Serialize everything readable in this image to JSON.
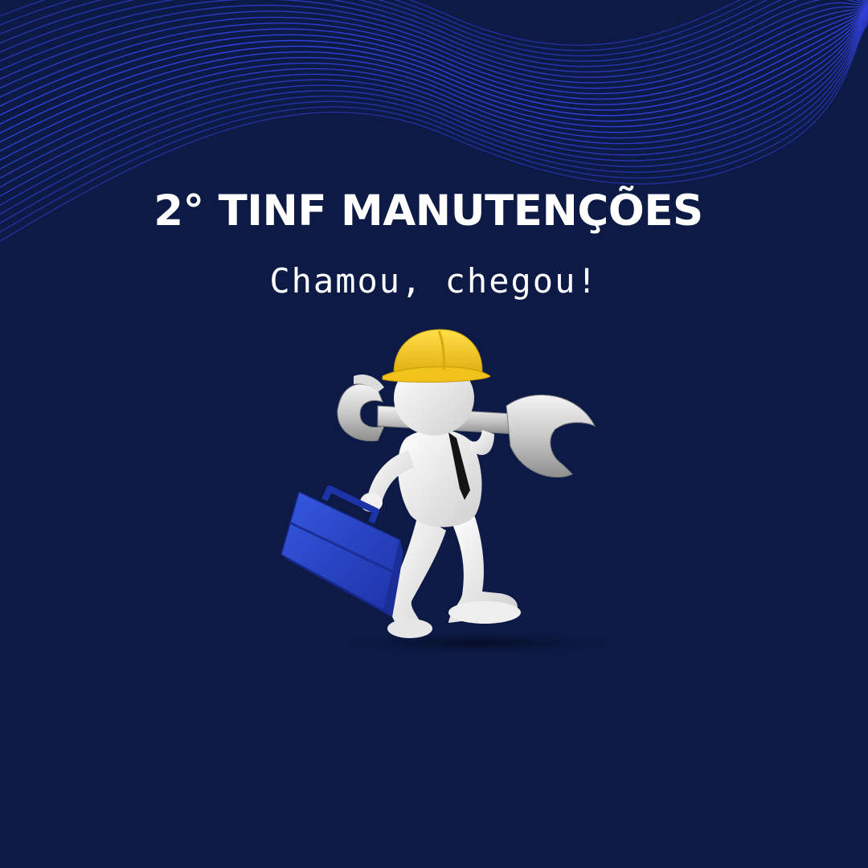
{
  "poster": {
    "title": "2° TINF MANUTENÇÕES",
    "subtitle": "Chamou, chegou!"
  },
  "illustration": {
    "description_icons": [
      "hard-hat-icon",
      "wrench-icon",
      "toolbox-icon"
    ]
  },
  "colors": {
    "background": "#0c1a45",
    "wave_lines": "#3343e0",
    "hat": "#f2c61f",
    "toolbox": "#2a47c8",
    "text": "#ffffff"
  }
}
